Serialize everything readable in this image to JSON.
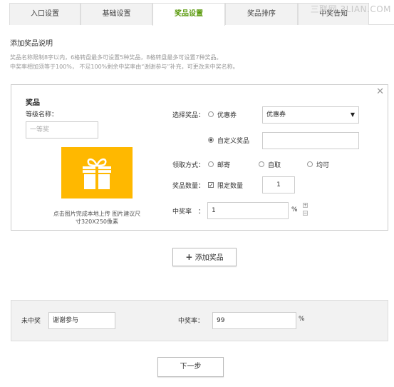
{
  "tabs": [
    {
      "label": "入口设置"
    },
    {
      "label": "基础设置"
    },
    {
      "label": "奖品设置"
    },
    {
      "label": "奖品排序"
    },
    {
      "label": "中奖告知"
    }
  ],
  "watermark": "三联网 3LIAN.COM",
  "description": {
    "title": "添加奖品说明",
    "line1": "奖品名称限制8字以内，6格转盘最多可设置5种奖品，8格转盘最多可设置7种奖品。",
    "line2": "中奖率相加须等于100%，   不足100%剩余中奖率由“谢谢参与”补充，可更改未中奖名称。"
  },
  "prize": {
    "close_icon": "close-icon",
    "heading": "奖品",
    "level_label": "等级名称：",
    "level_placeholder": "一等奖",
    "gift_icon": "gift-icon",
    "upload_text": "点击图片完成本地上传 图片建议尺寸320X250像素",
    "select_label": "选择奖品：",
    "option_coupon": "优惠券",
    "coupon_select_value": "优惠券",
    "option_custom": "自定义奖品",
    "custom_value": "",
    "claim_label": "领取方式：",
    "claim_options": [
      "邮寄",
      "自取",
      "均可"
    ],
    "quantity_label": "奖品数量：",
    "limit_label": "限定数量",
    "limit_checked": true,
    "quantity_value": "1",
    "rate_label": "中奖率",
    "rate_colon": "：",
    "rate_value": "1",
    "percent": "%"
  },
  "add_prize_button": "添加奖品",
  "no_win": {
    "label": "未中奖",
    "name_value": "谢谢参与",
    "rate_label": "中奖率：",
    "rate_value": "99",
    "percent": "%"
  },
  "next_button": "下一步",
  "colors": {
    "accent_green": "#5a9a0d",
    "gift_orange": "#ffb800"
  }
}
